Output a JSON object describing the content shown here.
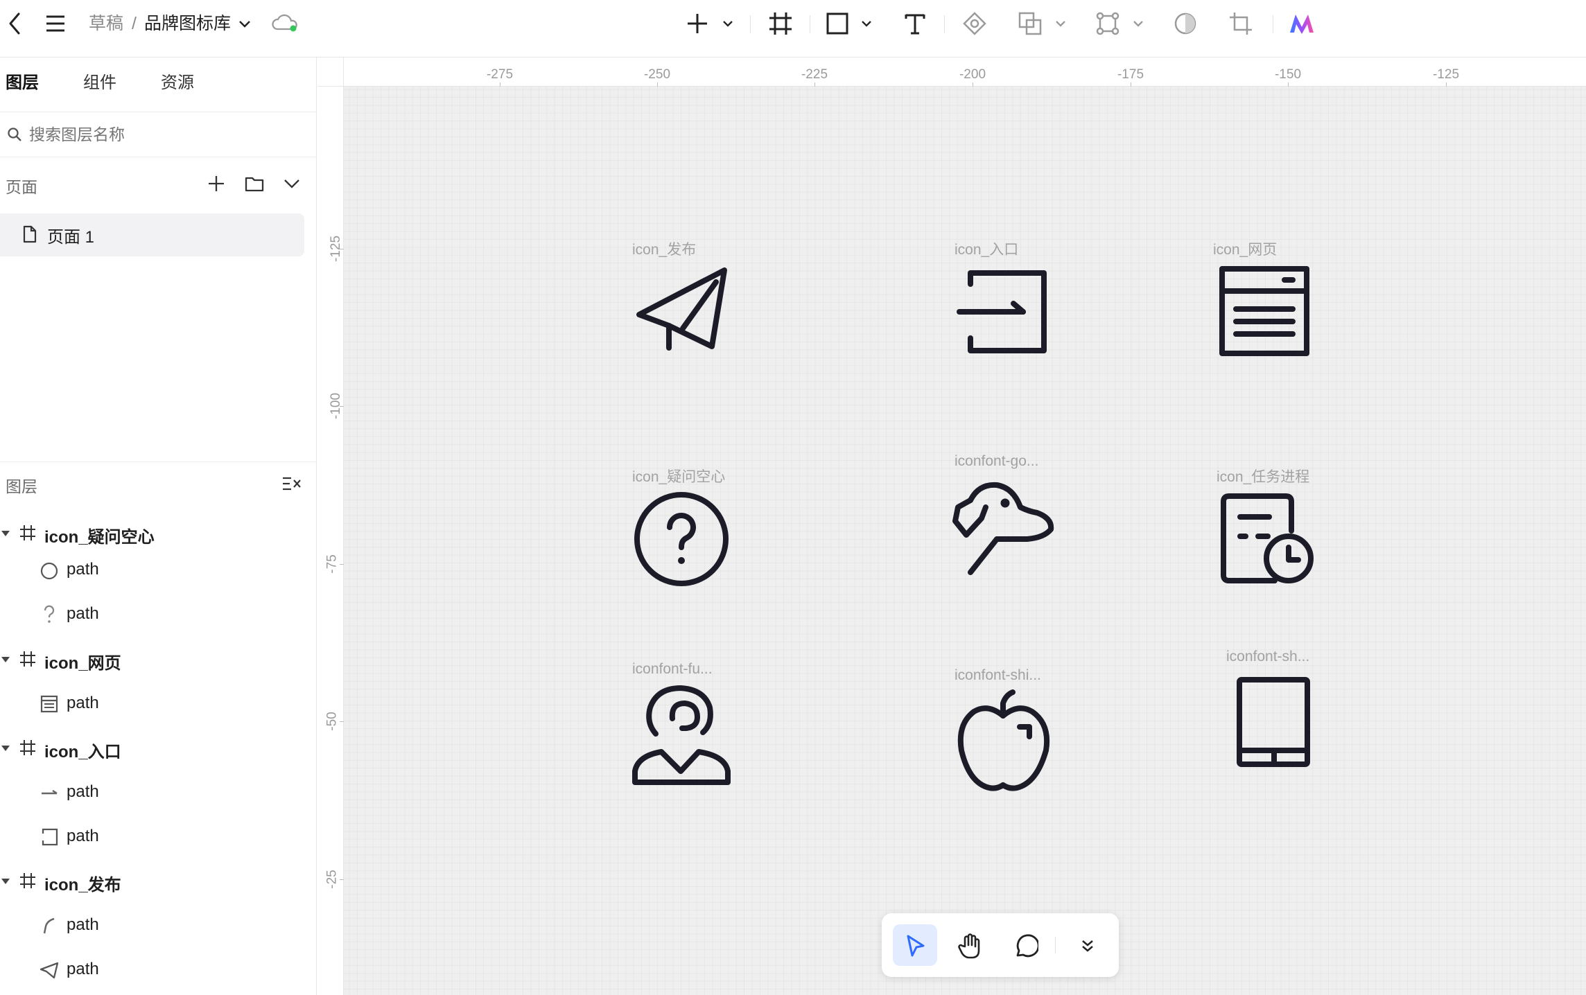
{
  "breadcrumb": {
    "parent": "草稿",
    "separator": "/",
    "current": "品牌图标库"
  },
  "left_tabs": [
    "图层",
    "组件",
    "资源"
  ],
  "search": {
    "placeholder": "搜索图层名称"
  },
  "pages": {
    "title": "页面",
    "items": [
      {
        "label": "页面 1"
      }
    ]
  },
  "layers": {
    "title": "图层",
    "groups": [
      {
        "name": "icon_疑问空心",
        "children": [
          {
            "label": "path",
            "icon": "circle-outline-icon"
          },
          {
            "label": "path",
            "icon": "question-mark-icon"
          }
        ]
      },
      {
        "name": "icon_网页",
        "children": [
          {
            "label": "path",
            "icon": "webpage-icon"
          }
        ]
      },
      {
        "name": "icon_入口",
        "children": [
          {
            "label": "path",
            "icon": "arrow-line-icon"
          },
          {
            "label": "path",
            "icon": "bracket-icon"
          }
        ]
      },
      {
        "name": "icon_发布",
        "children": [
          {
            "label": "path",
            "icon": "curve-line-icon"
          },
          {
            "label": "path",
            "icon": "paper-plane-icon"
          }
        ]
      }
    ]
  },
  "ruler": {
    "x_ticks": [
      "-275",
      "-250",
      "-225",
      "-200",
      "-175",
      "-150",
      "-125"
    ],
    "y_ticks": [
      "-125",
      "-100",
      "-75",
      "-50",
      "-25"
    ]
  },
  "canvas": {
    "frames": [
      {
        "label": "icon_发布",
        "icon": "paper-plane-icon"
      },
      {
        "label": "icon_入口",
        "icon": "login-entry-icon"
      },
      {
        "label": "icon_网页",
        "icon": "webpage-icon"
      },
      {
        "label": "icon_疑问空心",
        "icon": "question-circle-icon"
      },
      {
        "label": "iconfont-go...",
        "icon": "dog-icon"
      },
      {
        "label": "icon_任务进程",
        "icon": "task-progress-icon"
      },
      {
        "label": "iconfont-fu...",
        "icon": "customer-service-icon"
      },
      {
        "label": "iconfont-shi...",
        "icon": "apple-icon"
      },
      {
        "label": "iconfont-sh...",
        "icon": "tablet-icon"
      }
    ]
  },
  "colors": {
    "accent": "#2f6bff",
    "cloud_status": "#35c759",
    "icon_stroke": "#1c1c28"
  }
}
